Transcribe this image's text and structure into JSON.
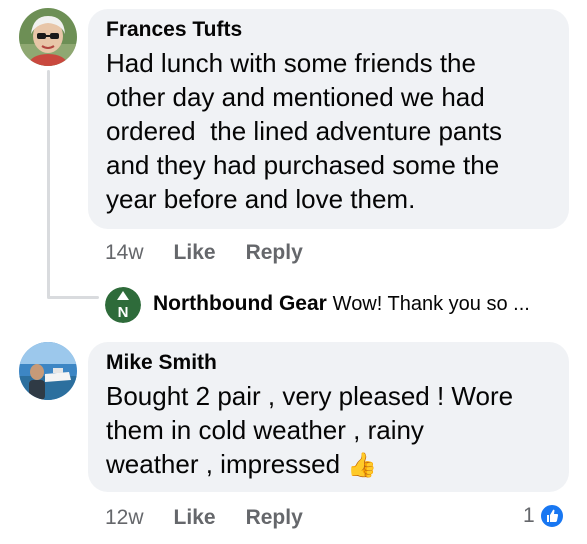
{
  "comments": [
    {
      "author": "Frances Tufts",
      "text_lines": [
        "Had lunch with some friends the",
        "other day and mentioned we had",
        "ordered  the lined adventure pants",
        "and they had purchased some the",
        "year before and love them."
      ],
      "timestamp": "14w",
      "like_label": "Like",
      "reply_label": "Reply"
    },
    {
      "author": "Mike Smith",
      "text_lines": [
        "Bought 2 pair , very pleased ! Wore",
        "them in cold weather , rainy",
        "weather , impressed"
      ],
      "emoji": "👍",
      "timestamp": "12w",
      "like_label": "Like",
      "reply_label": "Reply",
      "reaction_count": "1"
    }
  ],
  "reply": {
    "author": "Northbound Gear",
    "text": "Wow! Thank you so ...",
    "logo_letter": "N",
    "brand_color": "#2e6b3a"
  },
  "colors": {
    "bubble": "#f0f2f5",
    "meta": "#65676b",
    "like_blue": "#1877f2"
  },
  "icons": {
    "reaction": "like-thumb-icon"
  }
}
